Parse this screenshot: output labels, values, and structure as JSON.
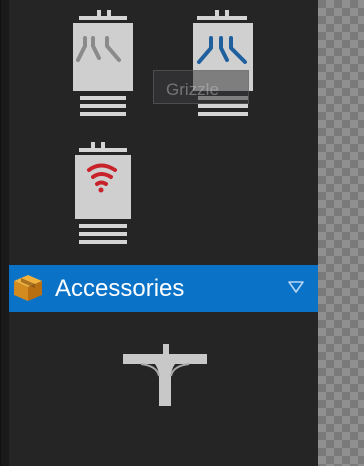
{
  "palette": {
    "devices": [
      {
        "icon": "access-point-icon",
        "accent_color": "#8a8a8a"
      },
      {
        "icon": "access-point-icon",
        "accent_color": "#1f5f9e"
      },
      {
        "icon": "wifi-icon",
        "accent_color": "#c8232b"
      }
    ],
    "tooltip": {
      "text": "Grizzle"
    },
    "category": {
      "label": "Accessories",
      "icon": "package-icon",
      "toggle_icon": "triangle-down-outline-icon",
      "highlight_color": "#0a73c8"
    },
    "accessories": [
      {
        "icon": "mount-bracket-icon"
      }
    ]
  }
}
